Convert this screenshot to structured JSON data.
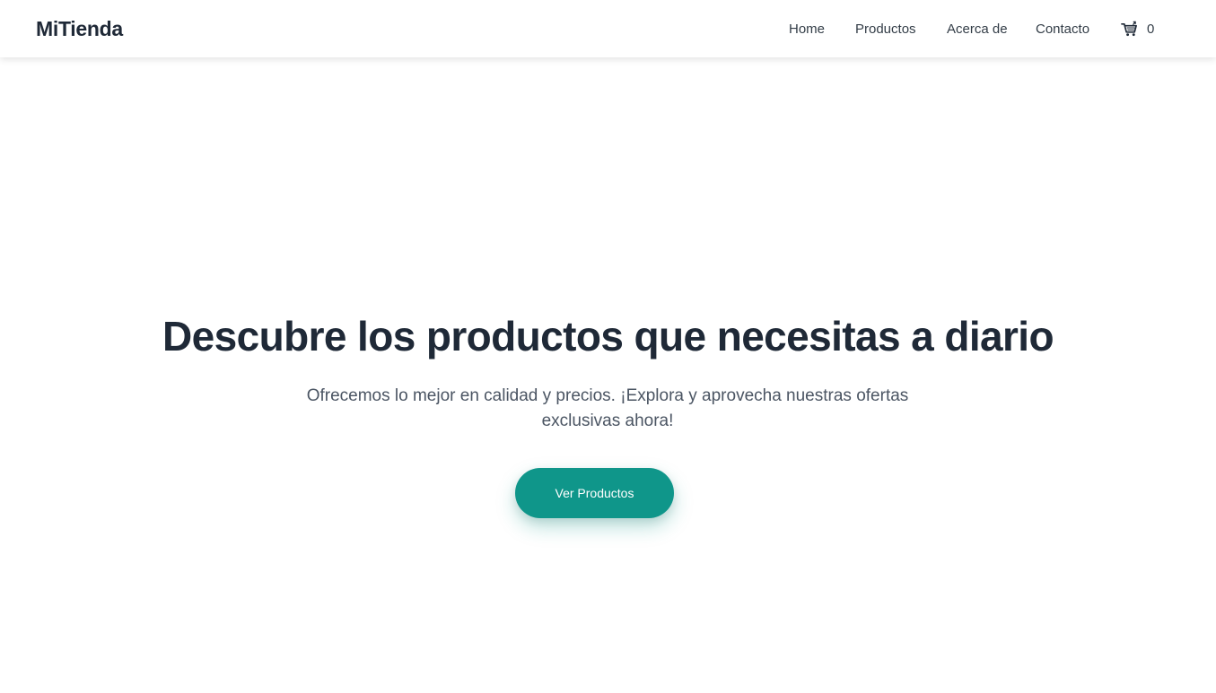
{
  "brand": {
    "name": "MiTienda"
  },
  "nav": {
    "items": [
      {
        "label": "Home"
      },
      {
        "label": "Productos"
      },
      {
        "label": "Acerca de"
      },
      {
        "label": "Contacto"
      }
    ],
    "cart": {
      "icon": "shopping-cart-icon",
      "count": "0"
    }
  },
  "hero": {
    "title": "Descubre los productos que necesitas a diario",
    "subtitle": "Ofrecemos lo mejor en calidad y precios. ¡Explora y aprovecha nuestras ofertas exclusivas ahora!",
    "cta_label": "Ver Productos"
  },
  "colors": {
    "accent": "#0f968a",
    "heading": "#1f2937",
    "text": "#4b5563",
    "background": "#ffffff"
  }
}
